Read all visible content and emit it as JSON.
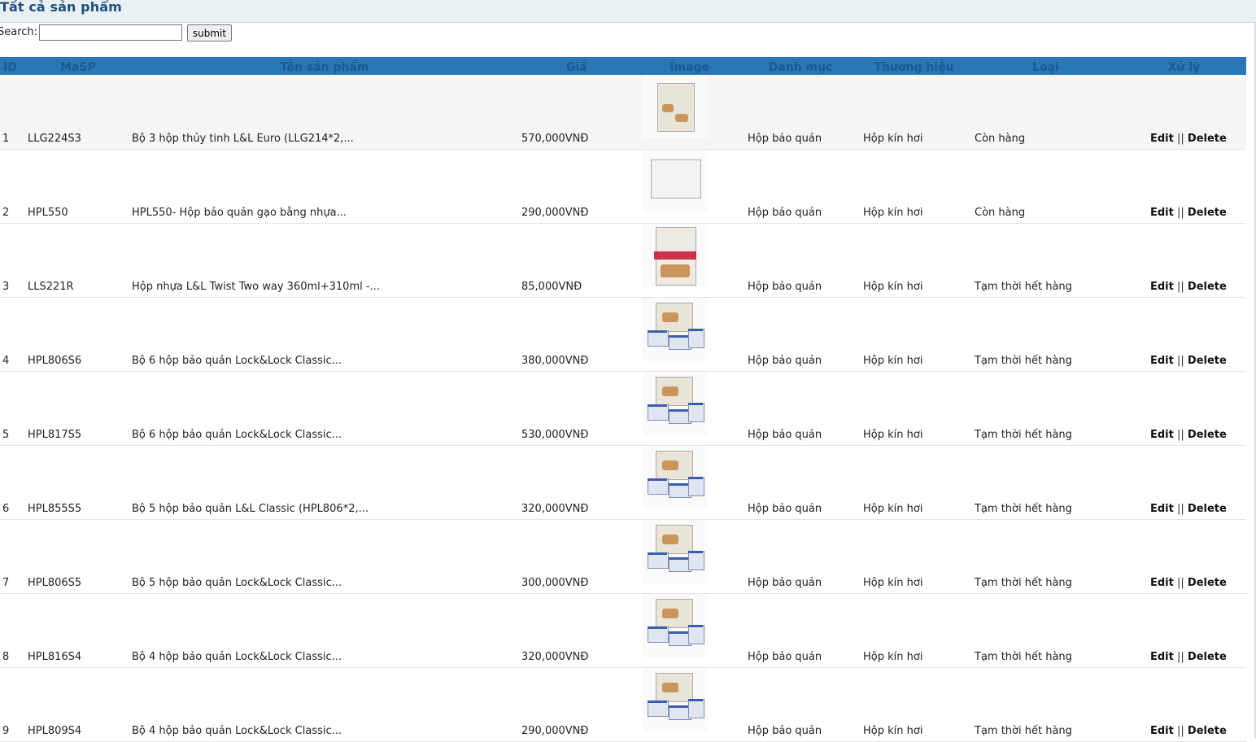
{
  "page": {
    "title": "Tất cả sản phẩm",
    "search_label": "Search:",
    "search_value": "",
    "submit_label": "submit"
  },
  "table": {
    "columns": [
      "ID",
      "MaSP",
      "Tên sản phẩm",
      "Giá",
      "Image",
      "Danh mục",
      "Thương hiệu",
      "Loại",
      "Xử lý"
    ],
    "rows": [
      {
        "id": "1",
        "masp": "LLG224S3",
        "name": "Bộ 3 hộp thủy tinh L&L Euro (LLG214*2,...",
        "price": "570,000VNĐ",
        "category": "Hộp bảo quản",
        "brand": "Hộp kín hơi",
        "type": "Còn hàng",
        "edit": "Edit",
        "sep": "||",
        "delete": "Delete",
        "image_icon": "product-box-icon"
      },
      {
        "id": "2",
        "masp": "HPL550",
        "name": "HPL550- Hộp bảo quản gạo bằng nhựa...",
        "price": "290,000VNĐ",
        "category": "Hộp bảo quản",
        "brand": "Hộp kín hơi",
        "type": "Còn hàng",
        "edit": "Edit",
        "sep": "||",
        "delete": "Delete",
        "image_icon": "rice-container-icon"
      },
      {
        "id": "3",
        "masp": "LLS221R",
        "name": "Hộp nhựa L&L Twist Two way 360ml+310ml -...",
        "price": "85,000VNĐ",
        "category": "Hộp bảo quản",
        "brand": "Hộp kín hơi",
        "type": "Tạm thời hết hàng",
        "edit": "Edit",
        "sep": "||",
        "delete": "Delete",
        "image_icon": "twist-jar-icon"
      },
      {
        "id": "4",
        "masp": "HPL806S6",
        "name": "Bộ 6 hộp bảo quản Lock&Lock Classic...",
        "price": "380,000VNĐ",
        "category": "Hộp bảo quản",
        "brand": "Hộp kín hơi",
        "type": "Tạm thời hết hàng",
        "edit": "Edit",
        "sep": "||",
        "delete": "Delete",
        "image_icon": "container-set-icon"
      },
      {
        "id": "5",
        "masp": "HPL817S5",
        "name": "Bộ 6 hộp bảo quản Lock&Lock Classic...",
        "price": "530,000VNĐ",
        "category": "Hộp bảo quản",
        "brand": "Hộp kín hơi",
        "type": "Tạm thời hết hàng",
        "edit": "Edit",
        "sep": "||",
        "delete": "Delete",
        "image_icon": "container-set-icon"
      },
      {
        "id": "6",
        "masp": "HPL855S5",
        "name": "Bộ 5 hộp bảo quản L&L Classic (HPL806*2,...",
        "price": "320,000VNĐ",
        "category": "Hộp bảo quản",
        "brand": "Hộp kín hơi",
        "type": "Tạm thời hết hàng",
        "edit": "Edit",
        "sep": "||",
        "delete": "Delete",
        "image_icon": "container-set-icon"
      },
      {
        "id": "7",
        "masp": "HPL806S5",
        "name": "Bộ 5 hộp bảo quản Lock&Lock Classic...",
        "price": "300,000VNĐ",
        "category": "Hộp bảo quản",
        "brand": "Hộp kín hơi",
        "type": "Tạm thời hết hàng",
        "edit": "Edit",
        "sep": "||",
        "delete": "Delete",
        "image_icon": "container-set-icon"
      },
      {
        "id": "8",
        "masp": "HPL816S4",
        "name": "Bộ 4 hộp bảo quản Lock&Lock Classic...",
        "price": "320,000VNĐ",
        "category": "Hộp bảo quản",
        "brand": "Hộp kín hơi",
        "type": "Tạm thời hết hàng",
        "edit": "Edit",
        "sep": "||",
        "delete": "Delete",
        "image_icon": "container-set-icon"
      },
      {
        "id": "9",
        "masp": "HPL809S4",
        "name": "Bộ 4 hộp bảo quản Lock&Lock Classic...",
        "price": "290,000VNĐ",
        "category": "Hộp bảo quản",
        "brand": "Hộp kín hơi",
        "type": "Tạm thời hết hàng",
        "edit": "Edit",
        "sep": "||",
        "delete": "Delete",
        "image_icon": "container-set-icon"
      }
    ]
  },
  "colors": {
    "header_bg": "#2a77b7",
    "header_text": "#1c5a90",
    "title_text": "#1f4f7b",
    "title_bar_bg": "#e8f0f3"
  }
}
